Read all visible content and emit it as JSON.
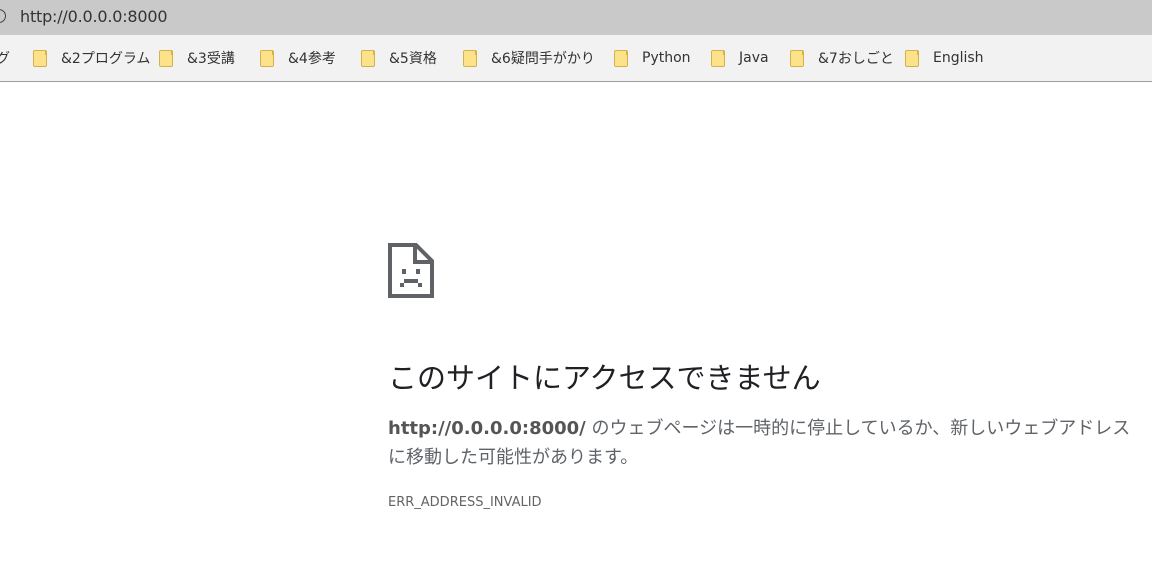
{
  "omnibox": {
    "url": "http://0.0.0.0:8000"
  },
  "bookmarks": {
    "truncated_label": "グ",
    "items": [
      {
        "label": "&2プログラム"
      },
      {
        "label": "&3受講"
      },
      {
        "label": "&4参考"
      },
      {
        "label": "&5資格"
      },
      {
        "label": "&6疑問手がかり"
      },
      {
        "label": "Python"
      },
      {
        "label": "Java"
      },
      {
        "label": "&7おしごと"
      },
      {
        "label": "English"
      }
    ]
  },
  "error": {
    "icon": "sad-page-icon",
    "title": "このサイトにアクセスできません",
    "url_bold": "http://0.0.0.0:8000/",
    "description": " のウェブページは一時的に停止しているか、新しいウェブアドレスに移動した可能性があります。",
    "code": "ERR_ADDRESS_INVALID"
  },
  "colors": {
    "omnibox_bg": "#c9c9c9",
    "bookmarks_bg": "#f2f2f2",
    "folder": "#fce38a"
  }
}
